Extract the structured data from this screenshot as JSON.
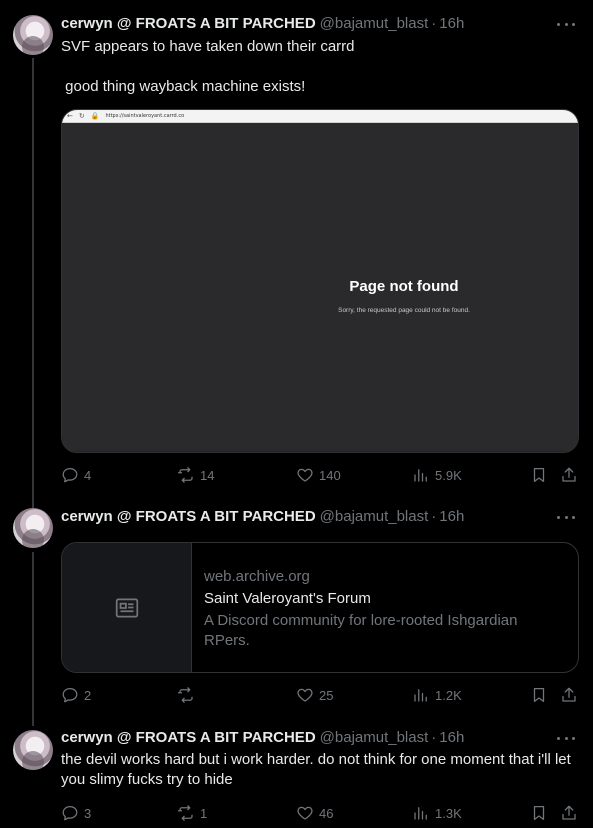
{
  "tweets": [
    {
      "name": "cerwyn @ FROATS A BIT PARCHED",
      "handle": "@bajamut_blast",
      "time": "16h",
      "text": "SVF appears to have taken down their carrd\n\n good thing wayback machine exists!",
      "media": {
        "url": "https://saintvaleroyant.carrd.co",
        "page_title": "Page not found",
        "page_subtitle": "Sorry, the requested page could not be found."
      },
      "stats": {
        "replies": "4",
        "reposts": "14",
        "likes": "140",
        "views": "5.9K"
      }
    },
    {
      "name": "cerwyn @ FROATS A BIT PARCHED",
      "handle": "@bajamut_blast",
      "time": "16h",
      "card": {
        "domain": "web.archive.org",
        "title": "Saint Valeroyant's Forum",
        "description": "A Discord community for lore-rooted Ishgardian RPers."
      },
      "stats": {
        "replies": "2",
        "reposts": "",
        "likes": "25",
        "views": "1.2K"
      }
    },
    {
      "name": "cerwyn @ FROATS A BIT PARCHED",
      "handle": "@bajamut_blast",
      "time": "16h",
      "text": "the devil works hard but i work harder. do not think for one moment that i'll let you slimy fucks try to hide",
      "stats": {
        "replies": "3",
        "reposts": "1",
        "likes": "46",
        "views": "1.3K"
      }
    }
  ],
  "separator": "·",
  "icons": [
    "more-icon",
    "reply-icon",
    "repost-icon",
    "like-icon",
    "views-icon",
    "bookmark-icon",
    "share-icon",
    "article-icon"
  ],
  "colors": {
    "background": "#000000",
    "text": "#e7e9ea",
    "muted": "#71767b",
    "border": "#2f3336"
  }
}
